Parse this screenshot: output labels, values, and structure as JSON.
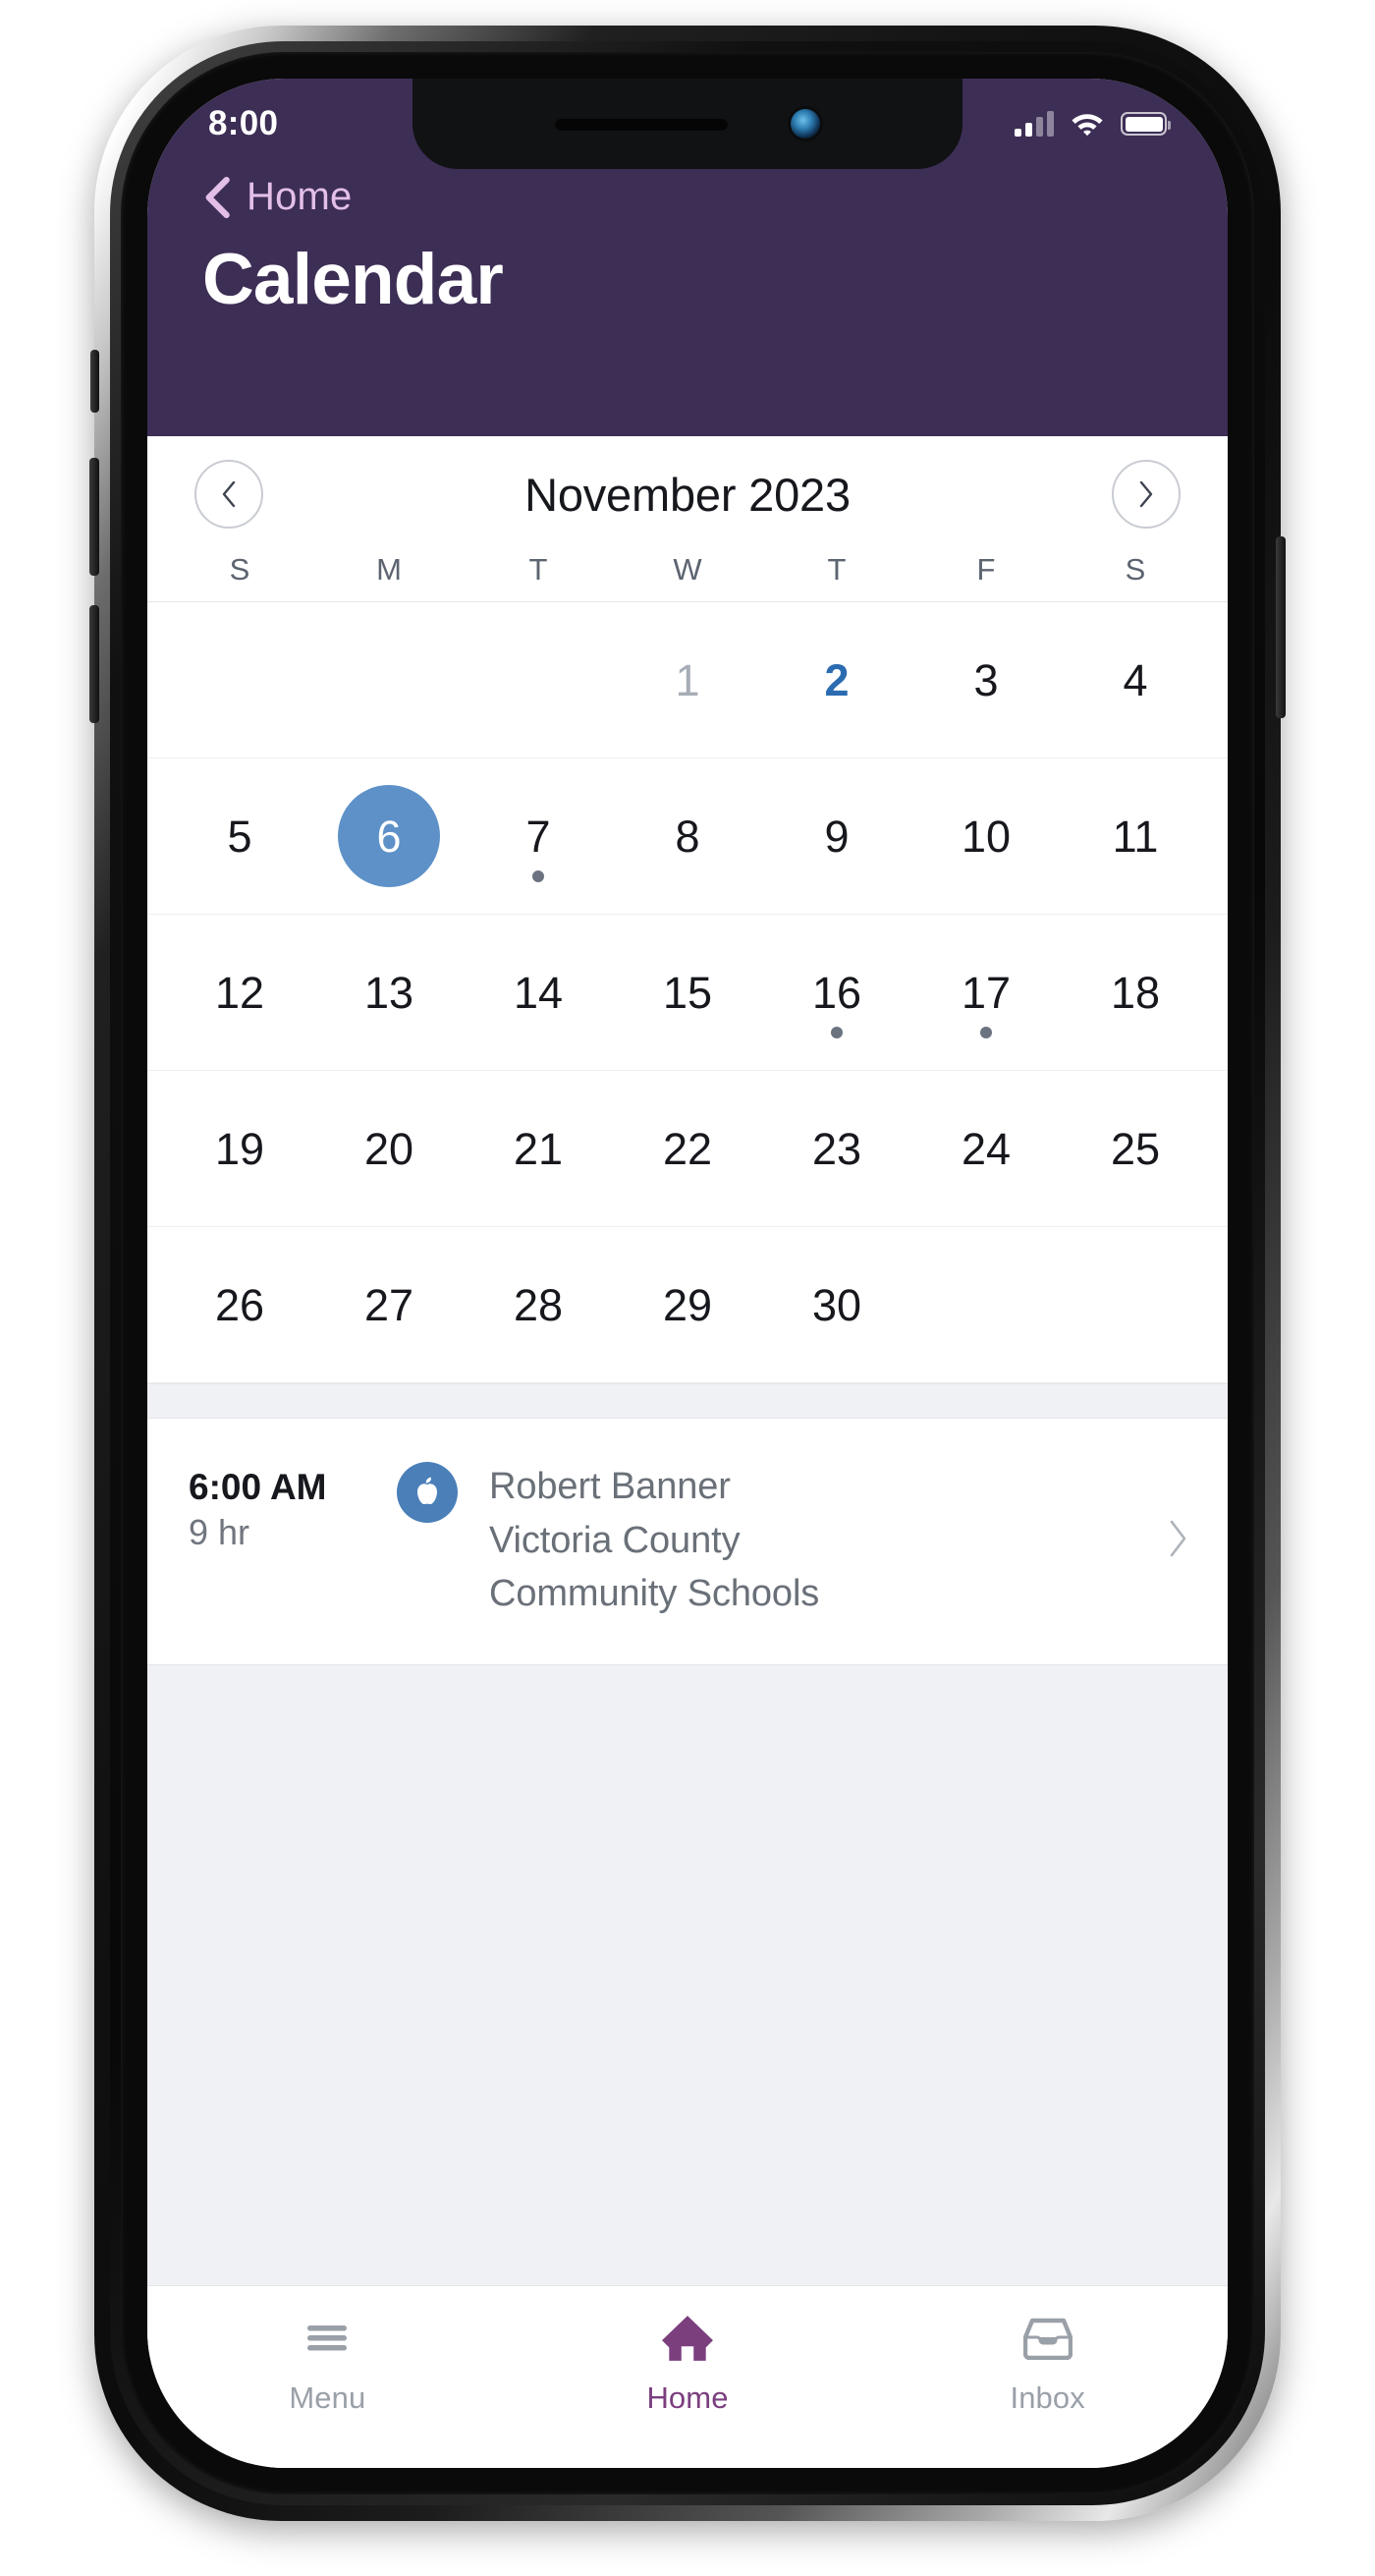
{
  "status_bar": {
    "time": "8:00",
    "signal_icon": "signal-bars-icon",
    "signal_bars_filled": 2,
    "signal_bars_total": 4,
    "wifi_icon": "wifi-icon",
    "battery_icon": "battery-full-icon"
  },
  "header": {
    "back_icon": "chevron-left-icon",
    "back_label": "Home",
    "title": "Calendar",
    "background_color": "#3d2e55",
    "back_label_color": "#e3bfe8"
  },
  "calendar": {
    "prev_icon": "chevron-left-icon",
    "next_icon": "chevron-right-icon",
    "month_label": "November 2023",
    "weekdays": [
      "S",
      "M",
      "T",
      "W",
      "T",
      "F",
      "S"
    ],
    "selected_color": "#5d91c8",
    "today_color": "#2b6cb0",
    "event_dot_color": "#6b7280",
    "weeks": [
      [
        {
          "day": "",
          "state": "empty"
        },
        {
          "day": "",
          "state": "empty"
        },
        {
          "day": "",
          "state": "empty"
        },
        {
          "day": "1",
          "state": "muted"
        },
        {
          "day": "2",
          "state": "today"
        },
        {
          "day": "3",
          "state": "normal"
        },
        {
          "day": "4",
          "state": "normal"
        }
      ],
      [
        {
          "day": "5",
          "state": "normal"
        },
        {
          "day": "6",
          "state": "selected"
        },
        {
          "day": "7",
          "state": "normal",
          "dot": true
        },
        {
          "day": "8",
          "state": "normal"
        },
        {
          "day": "9",
          "state": "normal"
        },
        {
          "day": "10",
          "state": "normal"
        },
        {
          "day": "11",
          "state": "normal"
        }
      ],
      [
        {
          "day": "12",
          "state": "normal"
        },
        {
          "day": "13",
          "state": "normal"
        },
        {
          "day": "14",
          "state": "normal"
        },
        {
          "day": "15",
          "state": "normal"
        },
        {
          "day": "16",
          "state": "normal",
          "dot": true
        },
        {
          "day": "17",
          "state": "normal",
          "dot": true
        },
        {
          "day": "18",
          "state": "normal"
        }
      ],
      [
        {
          "day": "19",
          "state": "normal"
        },
        {
          "day": "20",
          "state": "normal"
        },
        {
          "day": "21",
          "state": "normal"
        },
        {
          "day": "22",
          "state": "normal"
        },
        {
          "day": "23",
          "state": "normal"
        },
        {
          "day": "24",
          "state": "normal"
        },
        {
          "day": "25",
          "state": "normal"
        }
      ],
      [
        {
          "day": "26",
          "state": "normal"
        },
        {
          "day": "27",
          "state": "normal"
        },
        {
          "day": "28",
          "state": "normal"
        },
        {
          "day": "29",
          "state": "normal"
        },
        {
          "day": "30",
          "state": "normal"
        },
        {
          "day": "",
          "state": "empty"
        },
        {
          "day": "",
          "state": "empty"
        }
      ]
    ]
  },
  "events": [
    {
      "time": "6:00 AM",
      "duration": "9 hr",
      "icon": "apple-icon",
      "icon_color": "#4a7fb8",
      "lines": [
        "Robert Banner",
        "Victoria County",
        "Community Schools"
      ],
      "chevron_icon": "chevron-right-icon"
    }
  ],
  "tabbar": {
    "active_color": "#7b3f7e",
    "inactive_color": "#9aa0a8",
    "tabs": [
      {
        "label": "Menu",
        "icon": "hamburger-menu-icon",
        "active": false
      },
      {
        "label": "Home",
        "icon": "home-icon",
        "active": true
      },
      {
        "label": "Inbox",
        "icon": "inbox-tray-icon",
        "active": false
      }
    ]
  }
}
